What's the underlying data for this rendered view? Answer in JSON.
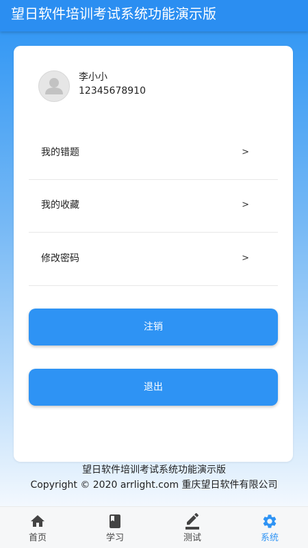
{
  "appbar": {
    "title": "望日软件培训考试系统功能演示版"
  },
  "profile": {
    "name": "李小小",
    "phone": "12345678910",
    "avatar_icon": "person-avatar-icon"
  },
  "menu": {
    "items": [
      {
        "label": "我的错题",
        "arrow": ">"
      },
      {
        "label": "我的收藏",
        "arrow": ">"
      },
      {
        "label": "修改密码",
        "arrow": ">"
      }
    ]
  },
  "actions": {
    "cancel_account_label": "注销",
    "logout_label": "退出"
  },
  "footer": {
    "line1": "望日软件培训考试系统功能演示版",
    "line2": "Copyright © 2020 arrlight.com 重庆望日软件有限公司"
  },
  "bottom_nav": {
    "items": [
      {
        "label": "首页",
        "icon": "home-icon"
      },
      {
        "label": "学习",
        "icon": "book-icon"
      },
      {
        "label": "测试",
        "icon": "edit-icon"
      },
      {
        "label": "系统",
        "icon": "settings-icon"
      }
    ],
    "active_index": 3
  },
  "colors": {
    "primary": "#2e93f4",
    "appbar": "#2b8ef1",
    "nav_inactive": "#444444"
  }
}
